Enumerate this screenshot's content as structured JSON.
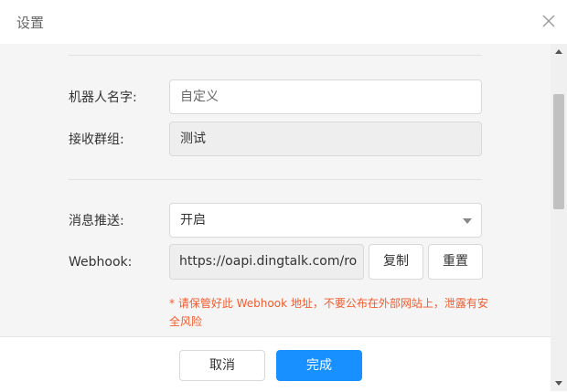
{
  "dialog": {
    "title": "设置",
    "close_icon": "close-icon"
  },
  "form": {
    "robot_name_label": "机器人名字:",
    "robot_name_placeholder": "自定义",
    "group_label": "接收群组:",
    "group_value": "测试",
    "push_label": "消息推送:",
    "push_value": "开启",
    "webhook_label": "Webhook:",
    "webhook_value": "https://oapi.dingtalk.com/ro",
    "copy_label": "复制",
    "reset_label": "重置",
    "warning": "* 请保管好此 Webhook 地址，不要公布在外部网站上，泄露有安全风险"
  },
  "footer": {
    "cancel_label": "取消",
    "done_label": "完成"
  },
  "colors": {
    "primary": "#1890ff",
    "warning": "#f25c2f"
  }
}
